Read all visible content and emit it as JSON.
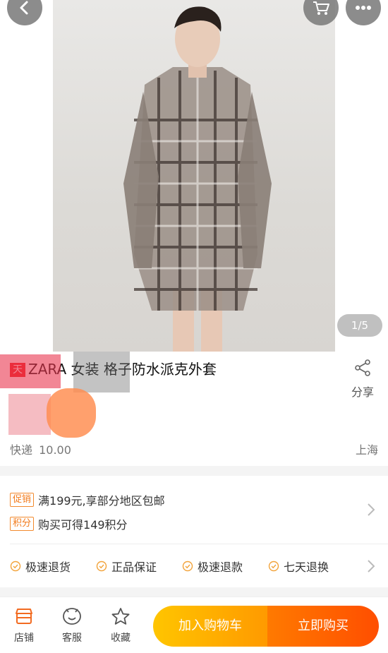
{
  "gallery": {
    "counter": "1/5"
  },
  "product": {
    "shop_tag": "天",
    "title": "ZARA 女装 格子防水派克外套",
    "share_label": "分享",
    "shipping_label": "快递",
    "shipping_fee": "10.00",
    "origin": "上海"
  },
  "promotions": [
    {
      "badge": "促销",
      "text": "满199元,享部分地区包邮"
    },
    {
      "badge": "积分",
      "text": "购买可得149积分"
    }
  ],
  "guarantees": [
    "极速退货",
    "正品保证",
    "极速退款",
    "七天退换"
  ],
  "bottom_bar": {
    "shop_label": "店铺",
    "service_label": "客服",
    "favorite_label": "收藏",
    "add_to_cart": "加入购物车",
    "buy_now": "立即购买"
  },
  "colors": {
    "accent": "#ff6a00",
    "promo_badge": "#f27a1a",
    "cart_start": "#ffc500",
    "buy_end": "#ff4e00"
  },
  "icons": [
    "back-icon",
    "cart-icon",
    "more-icon",
    "share-icon",
    "chevron-right-icon",
    "check-circle-icon",
    "store-icon",
    "service-icon",
    "star-icon"
  ]
}
